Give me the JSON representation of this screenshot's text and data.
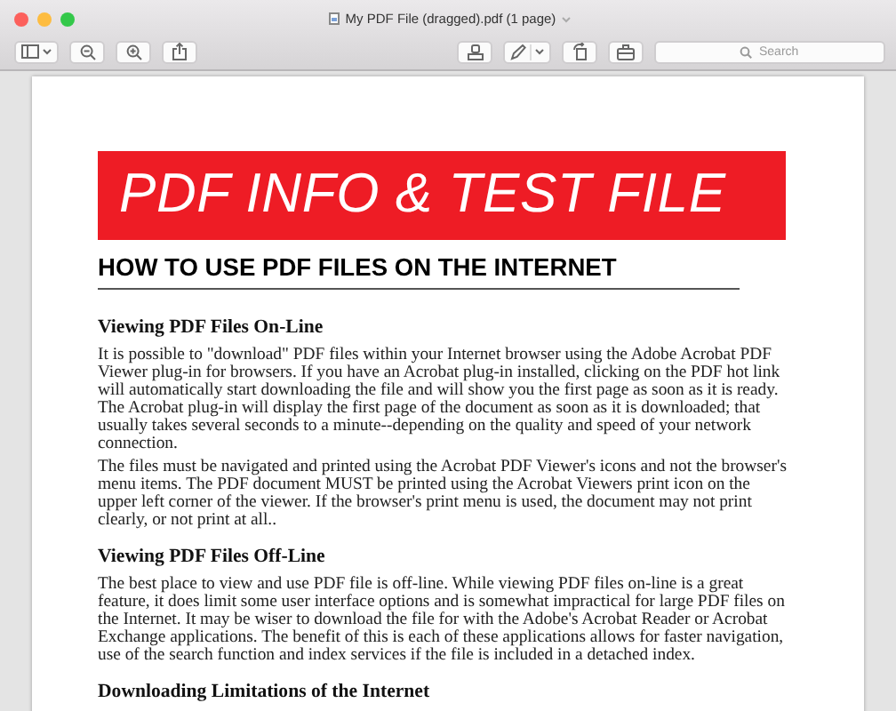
{
  "window": {
    "title": "My PDF File (dragged).pdf (1 page)"
  },
  "toolbar": {
    "search": {
      "placeholder": "Search"
    }
  },
  "document": {
    "banner": "PDF INFO & TEST FILE",
    "heading": "HOW TO USE PDF FILES ON THE INTERNET",
    "sections": [
      {
        "title": "Viewing PDF Files On-Line",
        "paragraphs": [
          "It is possible to \"download\" PDF files within your Internet browser using the Adobe Acrobat PDF Viewer plug-in for browsers. If you have an Acrobat plug-in installed, clicking on the PDF hot link will automatically start downloading the file and will show you the first page as soon as it is ready. The Acrobat plug-in will display the first page of the document as soon as it is downloaded; that usually takes several seconds to a minute--depending on the quality and speed of your network connection.",
          "The files must be navigated and printed using the Acrobat PDF Viewer's icons and not the browser's menu items. The PDF document MUST be printed using the Acrobat Viewers print icon on the upper left corner of the viewer. If the browser's print menu is used, the document may not print clearly, or not print at all.."
        ]
      },
      {
        "title": "Viewing PDF Files Off-Line",
        "paragraphs": [
          "The best place to view and use PDF file is off-line. While viewing PDF files on-line is a great feature, it does limit some user interface options and is somewhat impractical for large PDF files on the Internet. It may be wiser to download the file for with the Adobe's Acrobat Reader or Acrobat Exchange applications. The benefit of this is each of these applications allows for faster navigation, use of the search function and index services if the file is included in a detached index."
        ]
      },
      {
        "title": "Downloading Limitations of the Internet"
      }
    ]
  }
}
